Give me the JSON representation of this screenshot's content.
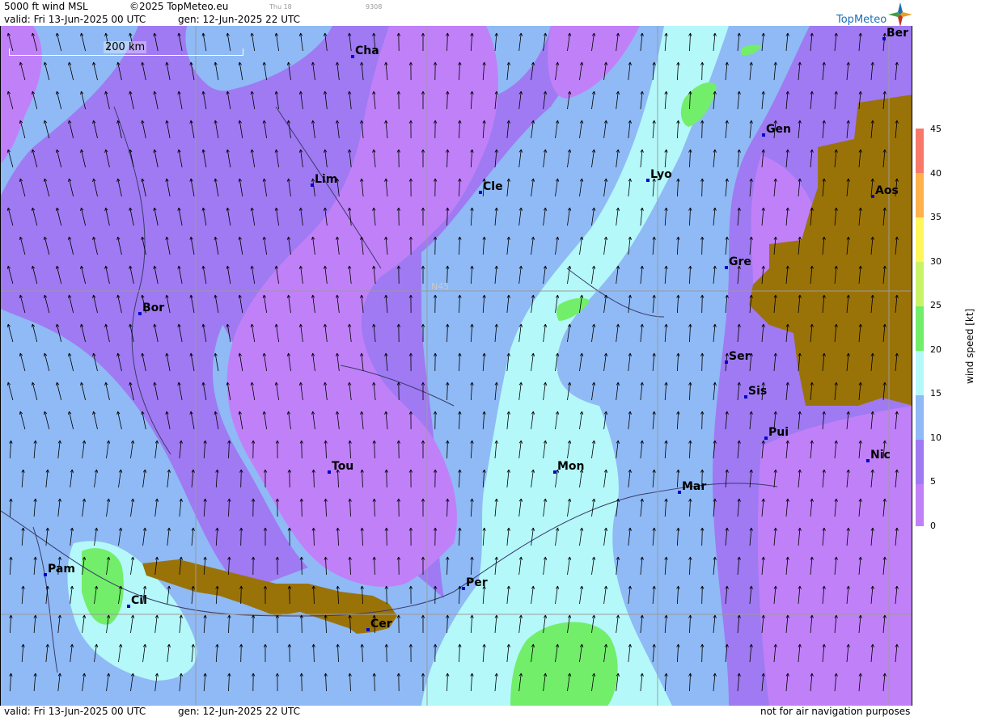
{
  "header": {
    "product": "5000 ft wind MSL",
    "copyright": "©2025 TopMeteo.eu",
    "day": "Thu 18",
    "code": "9308",
    "valid": "valid:  Fri  13-Jun-2025  00 UTC",
    "gen": "gen: 12-Jun-2025 22 UTC"
  },
  "footer": {
    "valid": "valid:  Fri  13-Jun-2025  00 UTC",
    "gen": "gen: 12-Jun-2025 22 UTC",
    "disclaimer": "not for air navigation purposes"
  },
  "logo": {
    "text": "TopMeteo"
  },
  "map": {
    "scale_label": "200 km",
    "grid_label": "N45",
    "cities": [
      {
        "name": "Cha"
      },
      {
        "name": "Ber"
      },
      {
        "name": "Gen"
      },
      {
        "name": "Lim"
      },
      {
        "name": "Cle"
      },
      {
        "name": "Lyo"
      },
      {
        "name": "Aos"
      },
      {
        "name": "Gre"
      },
      {
        "name": "Bor"
      },
      {
        "name": "Ser"
      },
      {
        "name": "Sis"
      },
      {
        "name": "Pui"
      },
      {
        "name": "Tou"
      },
      {
        "name": "Mon"
      },
      {
        "name": "Mar"
      },
      {
        "name": "Nic"
      },
      {
        "name": "Pam"
      },
      {
        "name": "Cil"
      },
      {
        "name": "Per"
      },
      {
        "name": "Cer"
      }
    ]
  },
  "legend": {
    "title": "wind  speed  [kt]",
    "ticks": [
      "45",
      "40",
      "35",
      "30",
      "25",
      "20",
      "15",
      "10",
      "5",
      "0"
    ],
    "colors": {
      "0-5": "#c080f8",
      "5-10": "#9f7af2",
      "10-15": "#8fbaf5",
      "15-20": "#b4f8fa",
      "20-25": "#72ee6a",
      "25-30": "#c9f46a",
      "30-35": "#fff65e",
      "35-40": "#ffb14c",
      "40-45": "#f8786a",
      "terrain": "#9a7308"
    }
  }
}
